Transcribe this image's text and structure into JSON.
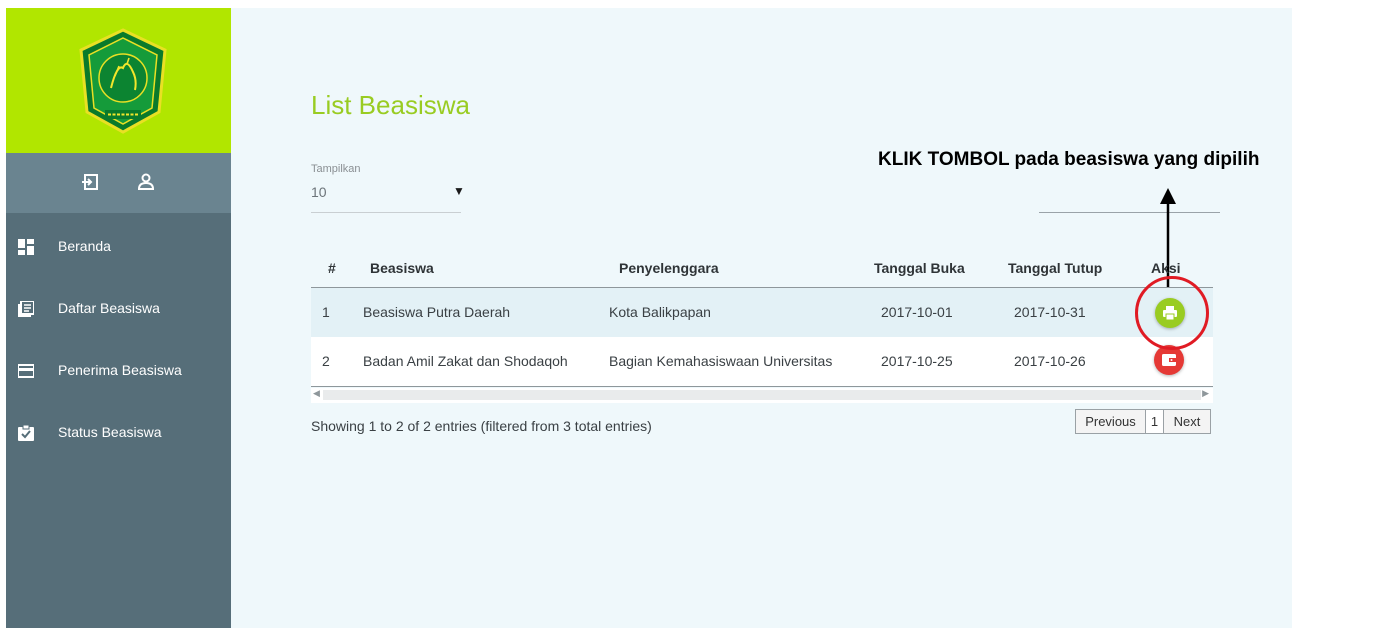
{
  "colors": {
    "brand_green": "#b1e600",
    "title_green": "#99cc22",
    "sidebar_bg": "#566e79",
    "sidebar_icon_bar": "#6a8490",
    "print_button": "#99cc22",
    "delete_button": "#e53935",
    "highlight_ring": "#e01b24"
  },
  "sidebar": {
    "logo": "university-seal-logo",
    "top_icons": [
      "login-icon",
      "user-icon"
    ],
    "items": [
      {
        "label": "Beranda",
        "icon": "dashboard-icon"
      },
      {
        "label": "Daftar Beasiswa",
        "icon": "list-icon"
      },
      {
        "label": "Penerima Beasiswa",
        "icon": "card-icon"
      },
      {
        "label": "Status Beasiswa",
        "icon": "clipboard-check-icon"
      }
    ]
  },
  "main": {
    "title": "List Beasiswa",
    "length_label": "Tampilkan",
    "length_value": "10",
    "search_value": ""
  },
  "annotation": {
    "text": "KLIK TOMBOL pada beasiswa yang dipilih"
  },
  "table": {
    "headers": [
      "#",
      "Beasiswa",
      "Penyelenggara",
      "Tanggal Buka",
      "Tanggal Tutup",
      "Aksi"
    ],
    "rows": [
      {
        "no": "1",
        "beasiswa": "Beasiswa Putra Daerah",
        "penyelenggara": "Kota Balikpapan",
        "buka": "2017-10-01",
        "tutup": "2017-10-31",
        "action_icon": "print-icon"
      },
      {
        "no": "2",
        "beasiswa": "Badan Amil Zakat dan Shodaqoh",
        "penyelenggara": "Bagian Kemahasiswaan Universitas",
        "buka": "2017-10-25",
        "tutup": "2017-10-26",
        "action_icon": "wallet-icon"
      }
    ]
  },
  "footer": {
    "info": "Showing 1 to 2 of 2 entries (filtered from 3 total entries)",
    "pagination": {
      "previous": "Previous",
      "page": "1",
      "next": "Next"
    }
  }
}
